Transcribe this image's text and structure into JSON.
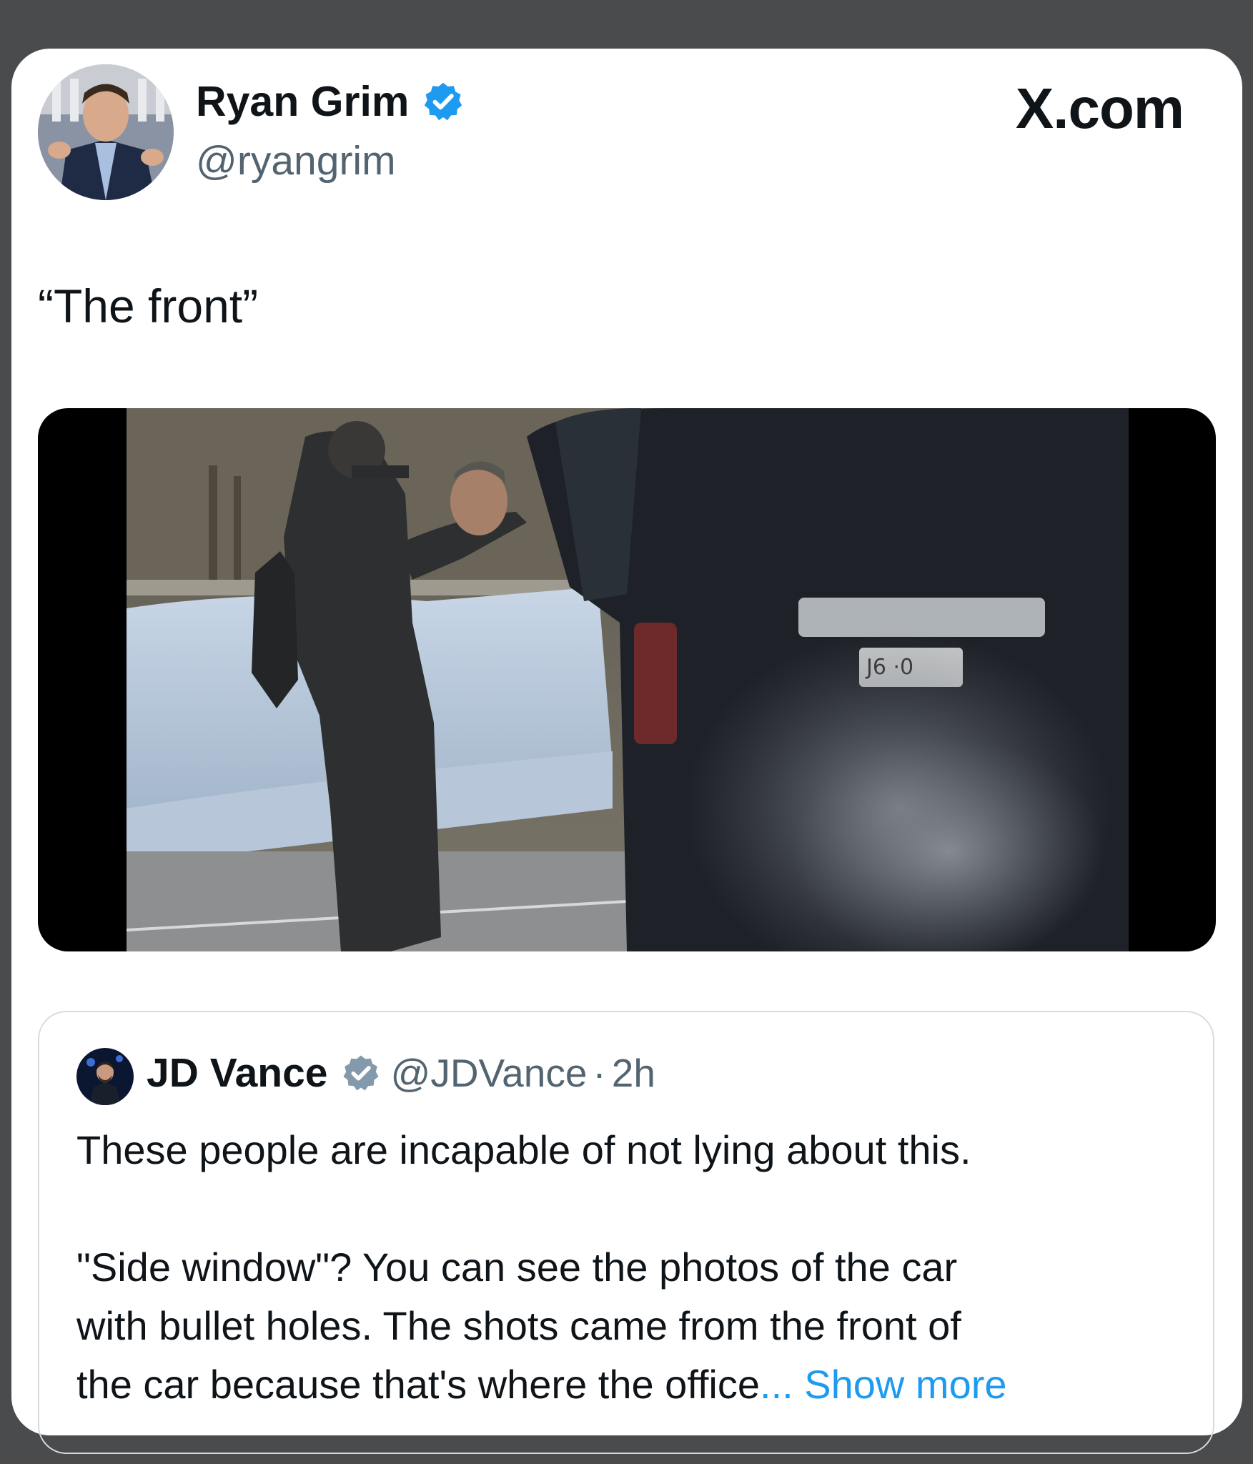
{
  "post": {
    "author_name": "Ryan Grim",
    "author_handle": "@ryangrim",
    "brand": "X.com",
    "text": "“The front”",
    "media_kind": "video-still"
  },
  "quoted_post": {
    "author_name": "JD Vance",
    "author_handle": "@JDVance",
    "separator": "·",
    "time": "2h",
    "line1": "These people are incapable of not lying about this.",
    "line2": "\"Side window\"? You can see the photos of the car",
    "line3": "with bullet holes. The shots came from the front of",
    "line4": "the car because that's where the office",
    "ellipsis": "...",
    "show_more": "Show more"
  },
  "colors": {
    "background": "#4a4b4d",
    "card": "#ffffff",
    "verified_blue": "#1d9bf0",
    "verified_gray": "#829aab",
    "link_blue": "#1d9bf0",
    "text_primary": "#0f1419",
    "text_secondary": "#536471"
  }
}
